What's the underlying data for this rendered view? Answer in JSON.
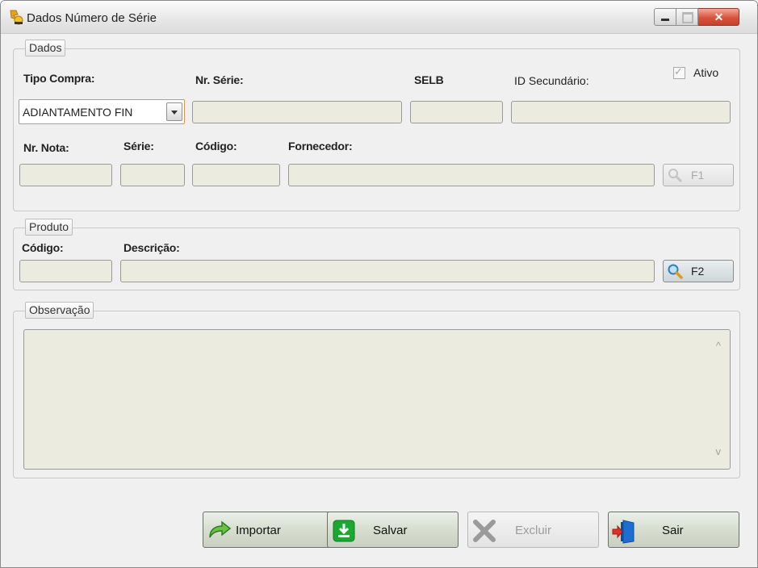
{
  "window": {
    "title": "Dados Número de Série",
    "close_label": "✕"
  },
  "dados": {
    "legend": "Dados",
    "tipo_compra_label": "Tipo Compra:",
    "tipo_compra_value": "ADIANTAMENTO FIN",
    "nr_serie_label": "Nr. Série:",
    "selb_label": "SELB",
    "id_secundario_label": "ID Secundário:",
    "ativo_label": "Ativo",
    "ativo_checked": true,
    "nr_nota_label": "Nr. Nota:",
    "serie_label": "Série:",
    "codigo_label": "Código:",
    "fornecedor_label": "Fornecedor:",
    "f1_label": "F1",
    "nr_serie_value": "",
    "selb_value": "",
    "id_secundario_value": "",
    "nr_nota_value": "",
    "serie_value": "",
    "codigo_value": "",
    "fornecedor_value": ""
  },
  "produto": {
    "legend": "Produto",
    "codigo_label": "Código:",
    "descricao_label": "Descrição:",
    "f2_label": "F2",
    "codigo_value": "",
    "descricao_value": ""
  },
  "observacao": {
    "legend": "Observação",
    "scroll_up": "^",
    "scroll_down": "v"
  },
  "actions": {
    "importar": "Importar",
    "salvar": "Salvar",
    "excluir": "Excluir",
    "sair": "Sair"
  },
  "colors": {
    "field_bg": "#ecebe0",
    "combo_border": "#e0914e",
    "close_red": "#d9533c",
    "salvar_green": "#1aa830",
    "sair_blue": "#1c6fd1"
  }
}
